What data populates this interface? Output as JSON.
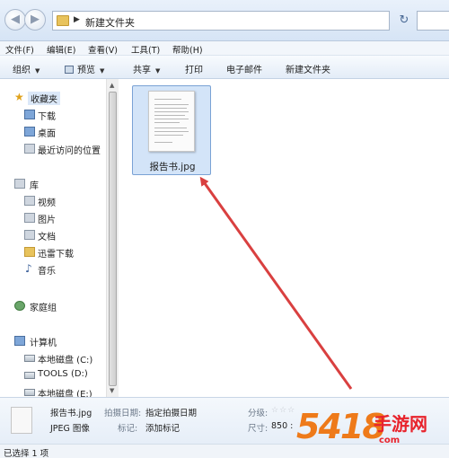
{
  "address": {
    "path": "新建文件夹"
  },
  "menu": [
    {
      "label": "文件(F)"
    },
    {
      "label": "编辑(E)"
    },
    {
      "label": "查看(V)"
    },
    {
      "label": "工具(T)"
    },
    {
      "label": "帮助(H)"
    }
  ],
  "toolbar": {
    "organize": "组织",
    "preview": "预览",
    "share": "共享",
    "print": "打印",
    "email": "电子邮件",
    "new_folder": "新建文件夹"
  },
  "nav": {
    "favorites": "收藏夹",
    "downloads": "下载",
    "desktop": "桌面",
    "recent": "最近访问的位置",
    "libraries": "库",
    "videos": "视频",
    "pictures": "图片",
    "documents": "文档",
    "thunder": "迅雷下载",
    "music": "音乐",
    "homegroup": "家庭组",
    "computer": "计算机",
    "drive_c": "本地磁盘 (C:)",
    "drive_d": "TOOLS (D:)",
    "drive_e": "本地磁盘 (E:)"
  },
  "file": {
    "name": "报告书.jpg"
  },
  "details": {
    "filename": "报告书.jpg",
    "type": "JPEG 图像",
    "date_label": "拍摄日期:",
    "date_value": "指定拍摄日期",
    "tags_label": "标记:",
    "tags_value": "添加标记",
    "rating_label": "分级:",
    "rating_stars": "☆☆☆",
    "size_label": "尺寸:",
    "size_value": "850 :"
  },
  "status": {
    "text": "已选择 1 项"
  },
  "watermark": {
    "digits": "5418",
    "text": "手游网",
    "domain": "com"
  },
  "colors": {
    "arrow": "#d94040",
    "selection": "#d3e4f8"
  }
}
